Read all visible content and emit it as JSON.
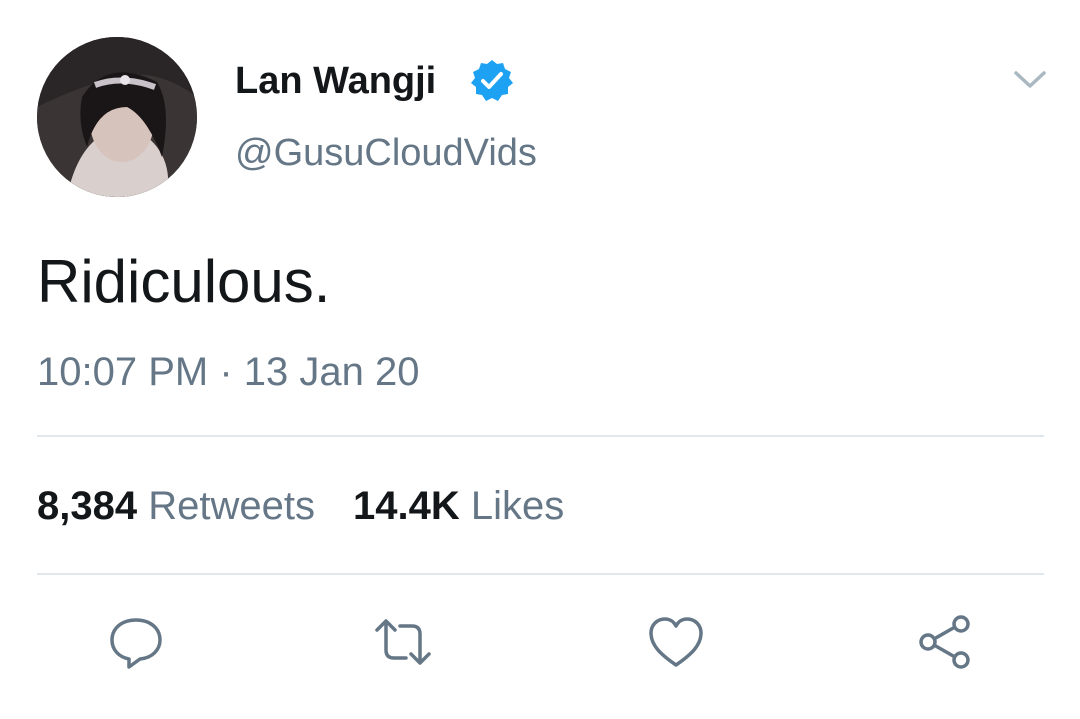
{
  "author": {
    "display_name": "Lan Wangji",
    "handle": "@GusuCloudVids",
    "verified": true,
    "avatar": "profile-photo"
  },
  "tweet": {
    "text": "Ridiculous.",
    "time": "10:07 PM",
    "separator": "·",
    "date": "13 Jan 20"
  },
  "stats": {
    "retweets_count": "8,384",
    "retweets_label": "Retweets",
    "likes_count": "14.4K",
    "likes_label": "Likes"
  },
  "actions": [
    {
      "name": "reply",
      "icon": "speech-bubble-icon"
    },
    {
      "name": "retweet",
      "icon": "retweet-arrows-icon"
    },
    {
      "name": "like",
      "icon": "heart-icon"
    },
    {
      "name": "share",
      "icon": "share-icon"
    }
  ],
  "colors": {
    "primary_text": "#14171a",
    "secondary_text": "#657786",
    "verified_blue": "#1da1f2",
    "divider": "#e1e8ed"
  }
}
